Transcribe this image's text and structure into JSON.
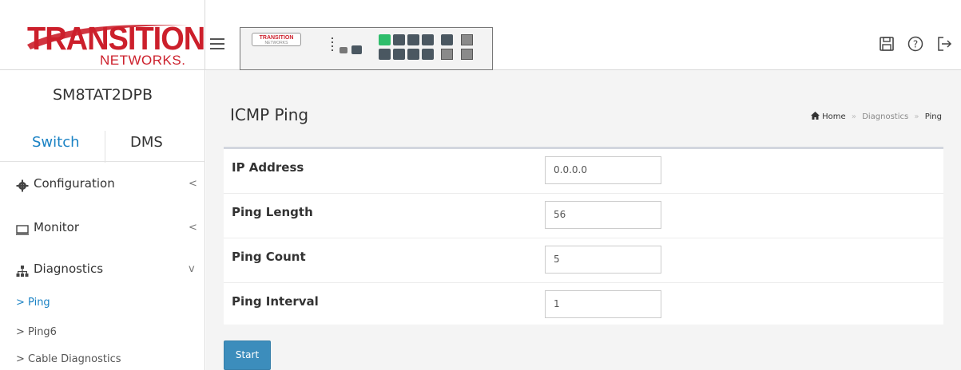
{
  "brand": {
    "logo_main": "TRANSITION",
    "logo_sub": "NETWORKS.",
    "device_logo": "TRANSITION",
    "device_logo_sub": "NETWORKS"
  },
  "header": {
    "menu_icon": "hamburger-icon",
    "tools": [
      {
        "name": "save-icon"
      },
      {
        "name": "help-icon"
      },
      {
        "name": "logout-icon"
      }
    ]
  },
  "sidebar": {
    "device_name": "SM8TAT2DPB",
    "tabs": {
      "switch": "Switch",
      "dms": "DMS"
    },
    "menu": [
      {
        "label": "Configuration",
        "icon": "gear-icon",
        "chevron": "<"
      },
      {
        "label": "Monitor",
        "icon": "monitor-icon",
        "chevron": "<"
      },
      {
        "label": "Diagnostics",
        "icon": "sitemap-icon",
        "chevron": "v"
      }
    ],
    "sub_items": [
      {
        "label": "> Ping",
        "active": true
      },
      {
        "label": "> Ping6",
        "active": false
      },
      {
        "label": "> Cable Diagnostics",
        "active": false
      }
    ]
  },
  "main": {
    "title": "ICMP Ping",
    "breadcrumb": {
      "home": "Home",
      "section": "Diagnostics",
      "current": "Ping",
      "sep": "»"
    },
    "fields": [
      {
        "label": "IP Address",
        "value": "0.0.0.0"
      },
      {
        "label": "Ping Length",
        "value": "56"
      },
      {
        "label": "Ping Count",
        "value": "5"
      },
      {
        "label": "Ping Interval",
        "value": "1"
      }
    ],
    "start_label": "Start"
  },
  "colors": {
    "brand_red": "#cc1f2b",
    "accent_blue": "#1a82c4",
    "button_blue": "#3c8dbc",
    "port_green": "#2ebd6b"
  }
}
